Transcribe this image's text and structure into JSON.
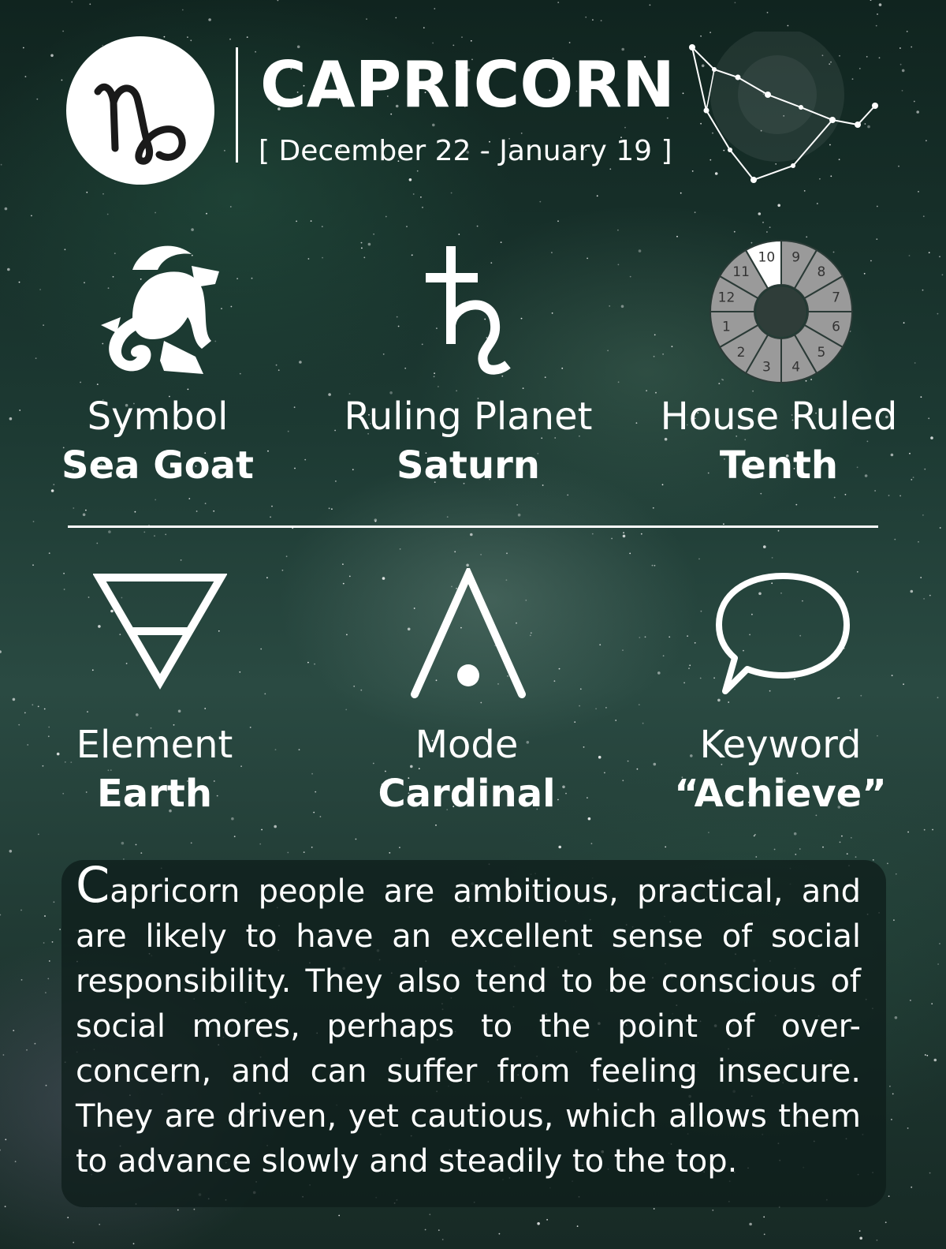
{
  "header": {
    "sign_glyph": "♑",
    "title": "CAPRICORN",
    "date_range": "[ December 22 - January 19 ]"
  },
  "info": {
    "symbol": {
      "label": "Symbol",
      "value": "Sea Goat",
      "icon": "sea-goat-icon"
    },
    "planet": {
      "label": "Ruling Planet",
      "value": "Saturn",
      "icon": "saturn-icon"
    },
    "house": {
      "label": "House Ruled",
      "value": "Tenth",
      "icon": "house-wheel-icon",
      "wheel_numbers": [
        "10",
        "9",
        "8",
        "7",
        "6",
        "5",
        "4",
        "3",
        "2",
        "1",
        "12",
        "11"
      ],
      "highlighted": "10"
    },
    "element": {
      "label": "Element",
      "value": "Earth",
      "icon": "earth-element-icon"
    },
    "mode": {
      "label": "Mode",
      "value": "Cardinal",
      "icon": "cardinal-mode-icon"
    },
    "keyword": {
      "label": "Keyword",
      "value": "“Achieve”",
      "icon": "speech-bubble-icon"
    }
  },
  "description": {
    "drop_cap": "C",
    "text": "apricorn people are ambitious, practical, and are likely to have an excellent sense of social responsibility. They also tend to be conscious of social mores, perhaps to the point of over-concern, and can suffer from feeling insecure. They are driven, yet cautious, which allows them to advance slowly and steadily to the top."
  },
  "colors": {
    "text": "#ffffff",
    "background_dark": "#10241f",
    "background_mid": "#2a4a42",
    "wheel_gray": "#9a9a9a"
  }
}
